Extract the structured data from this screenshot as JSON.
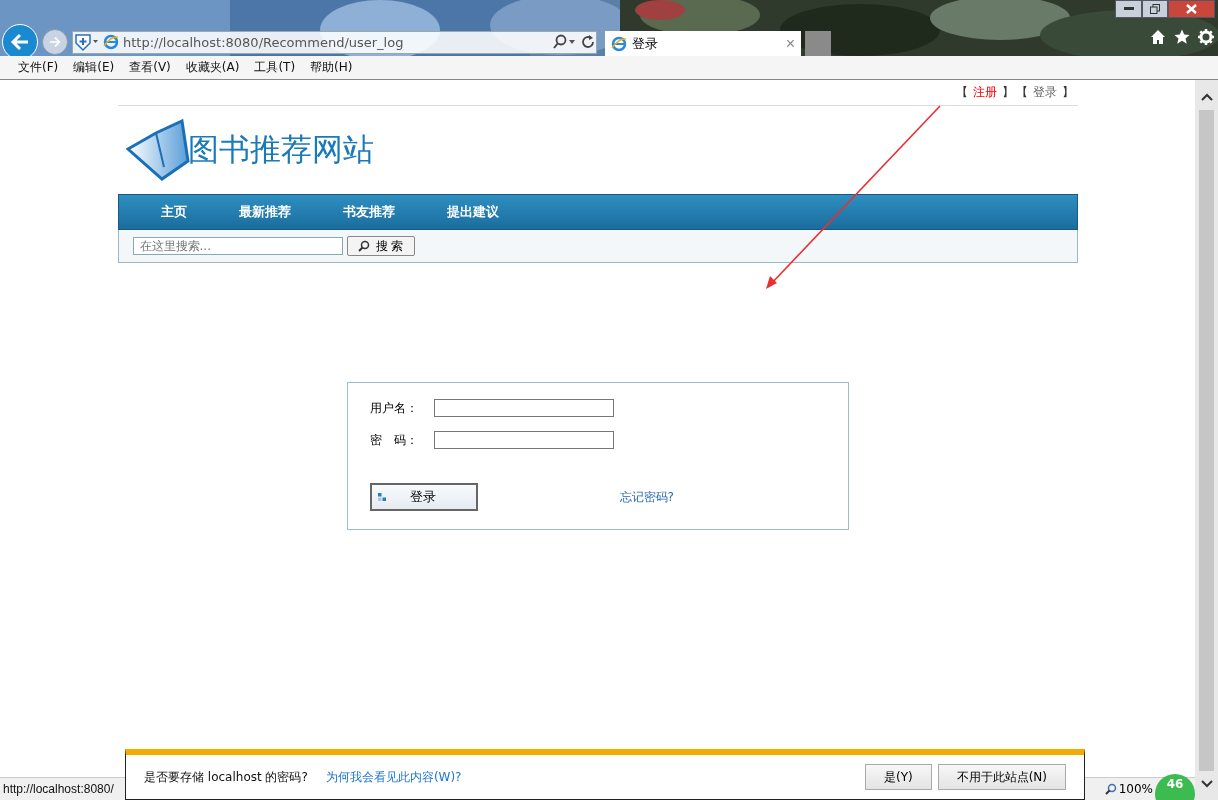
{
  "browser": {
    "address": "http://localhost:8080/Recommend/user_log",
    "tabs": [
      {
        "title": "登录",
        "close": "×",
        "selected": true
      }
    ]
  },
  "menu_bar": [
    "文件(F)",
    "编辑(E)",
    "查看(V)",
    "收藏夹(A)",
    "工具(T)",
    "帮助(H)"
  ],
  "page": {
    "top_links": [
      {
        "open": "【",
        "label": "注册",
        "close": "】",
        "color": "#ff0000"
      },
      {
        "open": "【",
        "label": "登录",
        "close": "】",
        "color": "#666666"
      }
    ],
    "site_title": "图书推荐网站",
    "nav": [
      "主页",
      "最新推荐",
      "书友推荐",
      "提出建议"
    ],
    "search": {
      "placeholder": "在这里搜索...",
      "button": "搜 索"
    },
    "login_form": {
      "fields": [
        {
          "label": "用户名："
        },
        {
          "label": "密　码："
        }
      ],
      "submit": "登录",
      "forgot_link": "忘记密码?"
    }
  },
  "password_prompt": {
    "message": "是否要存储 localhost 的密码?",
    "link": "为何我会看见此内容(W)?",
    "buttons": [
      "是(Y)",
      "不用于此站点(N)"
    ]
  },
  "status_bar": {
    "url": "http://localhost:8080/",
    "zoom": "100%",
    "badge": "46"
  }
}
